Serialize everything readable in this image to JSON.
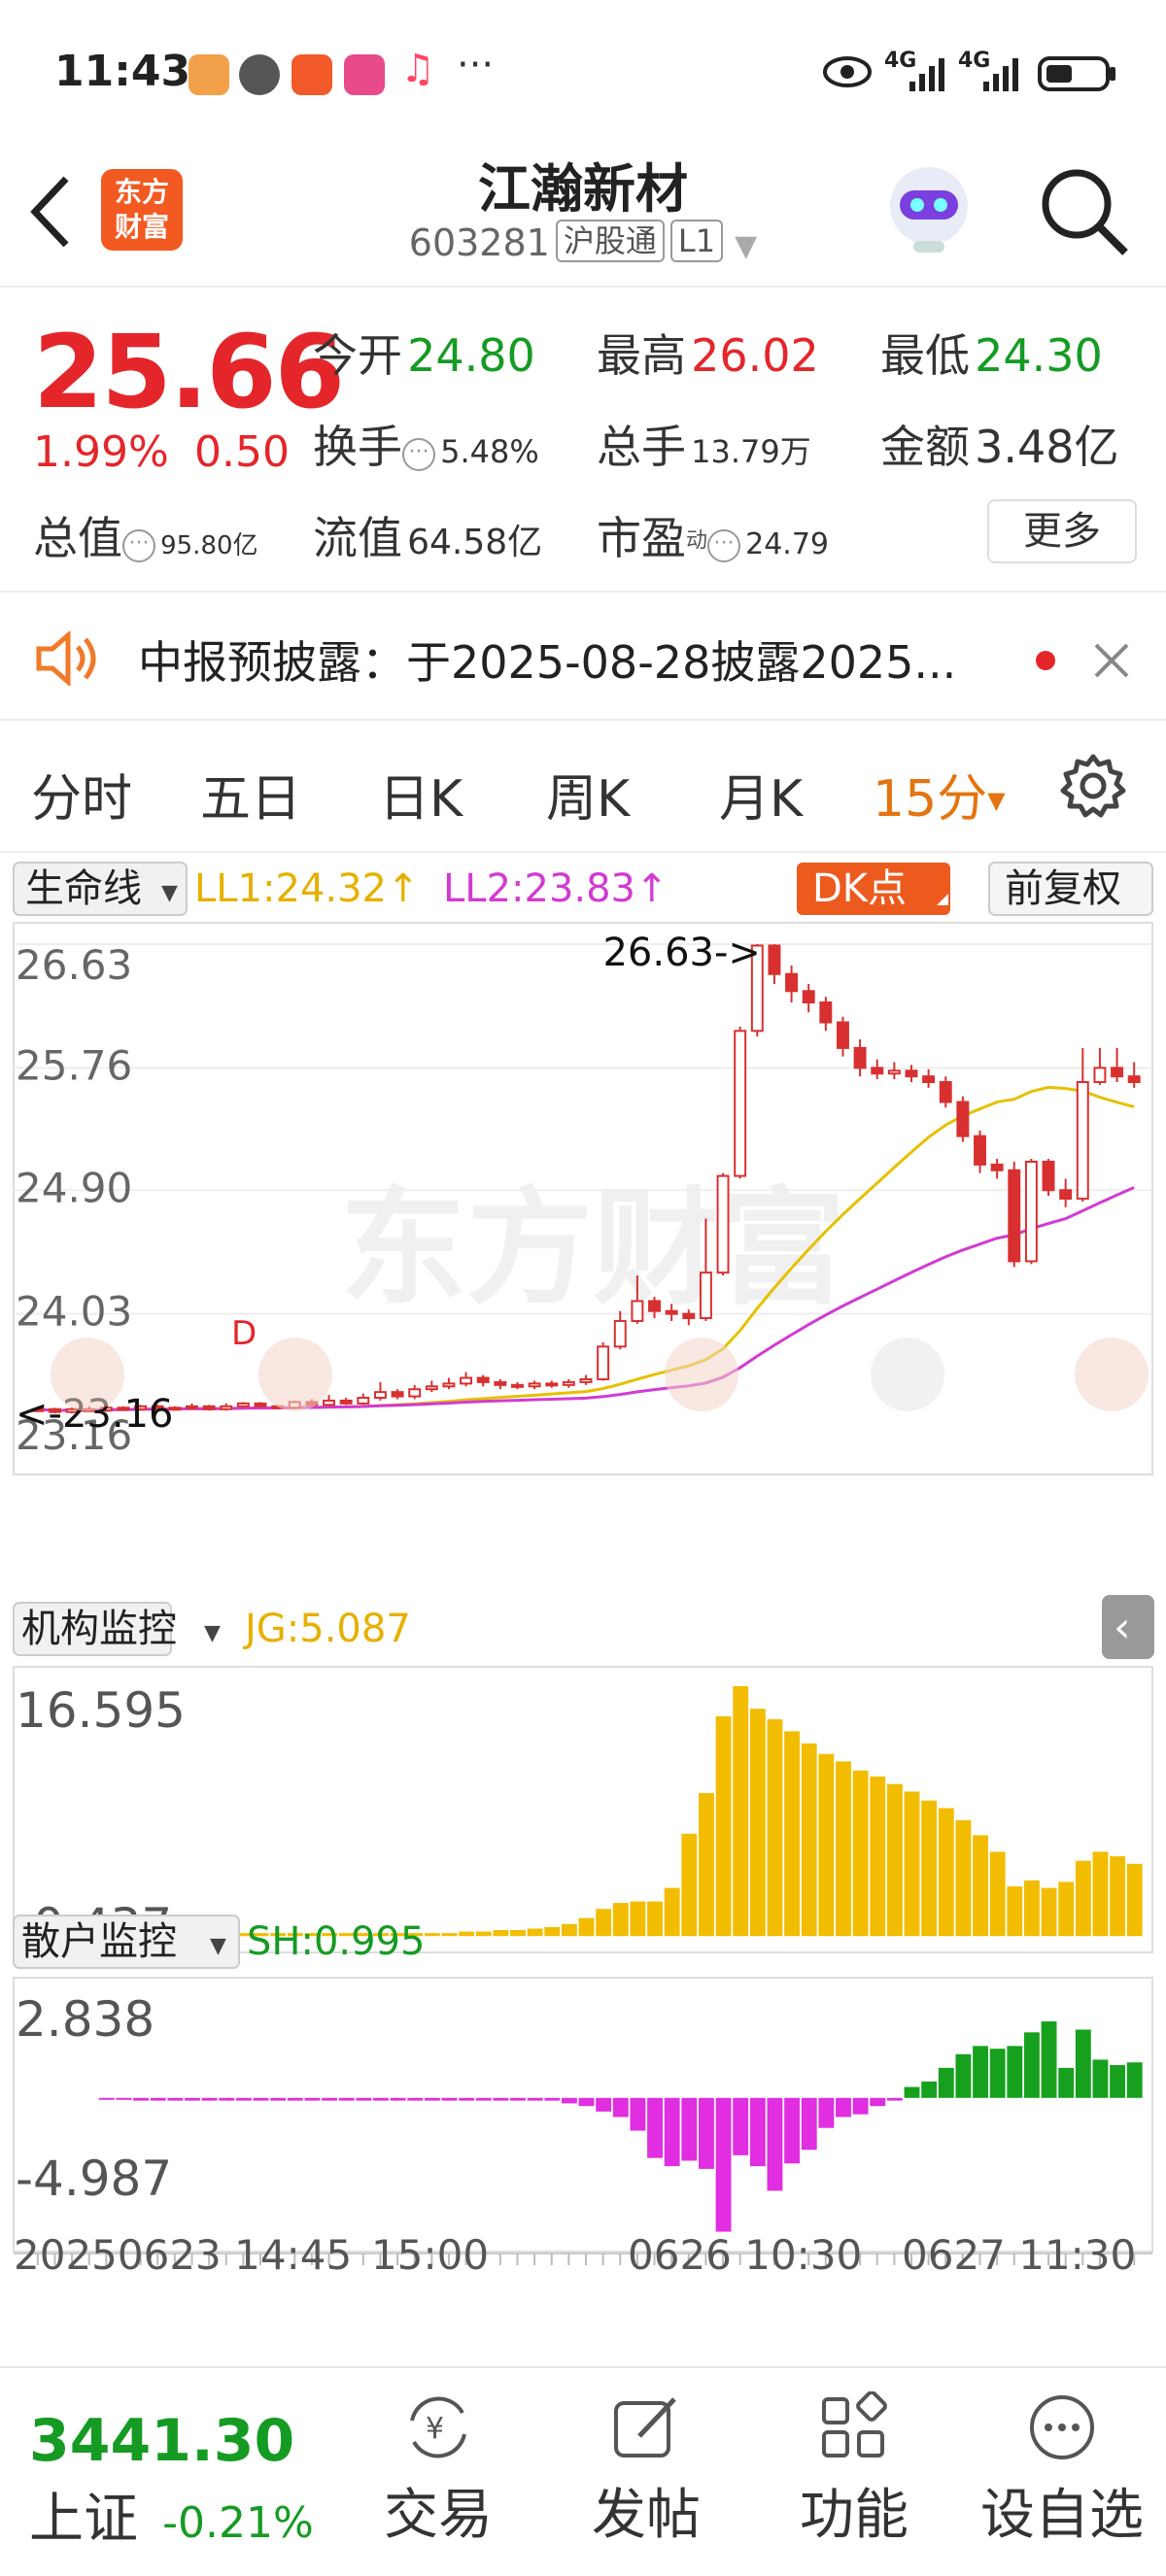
{
  "status_bar": {
    "time": "11:43",
    "more": "···",
    "net1": "4G",
    "net2": "4G",
    "app_colors": [
      "#f2a04a",
      "#555555",
      "#f25a2a",
      "#e84a8a",
      "#ff4466"
    ]
  },
  "header": {
    "logo_line1": "东方",
    "logo_line2": "财富",
    "stock_name": "江瀚新材",
    "stock_code": "603281",
    "tag1": "沪股通",
    "tag2": "L1"
  },
  "quote": {
    "price": "25.66",
    "change_pct": "1.99%",
    "change": "0.50",
    "open_label": "今开",
    "open": "24.80",
    "high_label": "最高",
    "high": "26.02",
    "low_label": "最低",
    "low": "24.30",
    "turnover_label": "换手",
    "turnover": "5.48%",
    "volume_label": "总手",
    "volume": "13.79万",
    "amount_label": "金额",
    "amount": "3.48亿",
    "mcap_label": "总值",
    "mcap": "95.80亿",
    "float_label": "流值",
    "float": "64.58亿",
    "pe_label": "市盈",
    "pe_sup": "动",
    "pe": "24.79",
    "more_button": "更多"
  },
  "notice": {
    "text": "中报预披露：于2025-08-28披露2025..."
  },
  "tabs": [
    {
      "label": "分时"
    },
    {
      "label": "五日"
    },
    {
      "label": "日K"
    },
    {
      "label": "周K"
    },
    {
      "label": "月K"
    },
    {
      "label": "15分"
    }
  ],
  "chart_toolbar": {
    "indicator": "生命线",
    "ll1": "LL1:24.32↑",
    "ll2": "LL2:23.83↑",
    "dk_button": "DK点",
    "adjust_button": "前复权",
    "watermark": "东方财富"
  },
  "chart_data": [
    {
      "type": "candlestick",
      "y_ticks": [
        "26.63",
        "25.76",
        "24.90",
        "24.03",
        "23.16"
      ],
      "ylim": [
        23.16,
        26.63
      ],
      "max_annotation": "26.63->",
      "min_annotation": "<-23.16",
      "marker": "D",
      "x_labels": [
        "20250623 14:45",
        "15:00",
        "0626 10:30",
        "0627 11:30"
      ],
      "candles": [
        [
          23.35,
          23.36,
          23.38,
          23.34
        ],
        [
          23.36,
          23.34,
          23.37,
          23.33
        ],
        [
          23.34,
          23.36,
          23.37,
          23.33
        ],
        [
          23.36,
          23.35,
          23.38,
          23.34
        ],
        [
          23.35,
          23.37,
          23.38,
          23.34
        ],
        [
          23.37,
          23.36,
          23.38,
          23.35
        ],
        [
          23.36,
          23.38,
          23.39,
          23.35
        ],
        [
          23.38,
          23.36,
          23.39,
          23.35
        ],
        [
          23.36,
          23.37,
          23.38,
          23.35
        ],
        [
          23.37,
          23.38,
          23.4,
          23.36
        ],
        [
          23.38,
          23.36,
          23.39,
          23.35
        ],
        [
          23.36,
          23.38,
          23.4,
          23.35
        ],
        [
          23.38,
          23.4,
          23.41,
          23.37
        ],
        [
          23.4,
          23.38,
          23.41,
          23.37
        ],
        [
          23.38,
          23.37,
          23.39,
          23.36
        ],
        [
          23.37,
          23.41,
          23.42,
          23.36
        ],
        [
          23.41,
          23.39,
          23.43,
          23.38
        ],
        [
          23.39,
          23.42,
          23.46,
          23.38
        ],
        [
          23.42,
          23.4,
          23.44,
          23.39
        ],
        [
          23.4,
          23.44,
          23.47,
          23.39
        ],
        [
          23.44,
          23.48,
          23.55,
          23.42
        ],
        [
          23.48,
          23.45,
          23.5,
          23.43
        ],
        [
          23.45,
          23.5,
          23.53,
          23.43
        ],
        [
          23.5,
          23.52,
          23.56,
          23.48
        ],
        [
          23.52,
          23.54,
          23.58,
          23.5
        ],
        [
          23.54,
          23.58,
          23.62,
          23.52
        ],
        [
          23.58,
          23.55,
          23.6,
          23.52
        ],
        [
          23.55,
          23.53,
          23.57,
          23.5
        ],
        [
          23.53,
          23.52,
          23.55,
          23.5
        ],
        [
          23.52,
          23.54,
          23.56,
          23.5
        ],
        [
          23.54,
          23.53,
          23.56,
          23.51
        ],
        [
          23.53,
          23.55,
          23.57,
          23.51
        ],
        [
          23.55,
          23.57,
          23.6,
          23.53
        ],
        [
          23.57,
          23.8,
          23.83,
          23.56
        ],
        [
          23.8,
          23.98,
          24.05,
          23.78
        ],
        [
          23.98,
          24.12,
          24.3,
          23.96
        ],
        [
          24.12,
          24.05,
          24.15,
          24.0
        ],
        [
          24.05,
          24.03,
          24.1,
          23.98
        ],
        [
          24.03,
          24.0,
          24.06,
          23.95
        ],
        [
          24.0,
          24.32,
          24.7,
          23.98
        ],
        [
          24.32,
          25.0,
          25.02,
          24.3
        ],
        [
          25.0,
          26.02,
          26.05,
          24.98
        ],
        [
          26.02,
          26.62,
          26.63,
          25.98
        ],
        [
          26.62,
          26.42,
          26.63,
          26.35
        ],
        [
          26.42,
          26.3,
          26.48,
          26.22
        ],
        [
          26.3,
          26.22,
          26.35,
          26.15
        ],
        [
          26.22,
          26.08,
          26.26,
          26.02
        ],
        [
          26.08,
          25.9,
          26.12,
          25.84
        ],
        [
          25.9,
          25.76,
          25.96,
          25.7
        ],
        [
          25.76,
          25.72,
          25.82,
          25.68
        ],
        [
          25.72,
          25.74,
          25.8,
          25.68
        ],
        [
          25.74,
          25.7,
          25.78,
          25.66
        ],
        [
          25.7,
          25.66,
          25.75,
          25.62
        ],
        [
          25.66,
          25.52,
          25.7,
          25.48
        ],
        [
          25.52,
          25.28,
          25.56,
          25.24
        ],
        [
          25.28,
          25.08,
          25.32,
          25.02
        ],
        [
          25.08,
          25.04,
          25.12,
          24.98
        ],
        [
          25.04,
          24.4,
          25.1,
          24.36
        ],
        [
          24.4,
          25.1,
          25.12,
          24.38
        ],
        [
          25.1,
          24.9,
          25.12,
          24.86
        ],
        [
          24.9,
          24.84,
          24.98,
          24.78
        ],
        [
          24.84,
          25.66,
          25.9,
          24.82
        ],
        [
          25.66,
          25.76,
          25.9,
          25.64
        ],
        [
          25.76,
          25.7,
          25.9,
          25.66
        ],
        [
          25.7,
          25.66,
          25.8,
          25.62
        ]
      ]
    },
    {
      "type": "bar",
      "title": "机构监控",
      "series_label": "JG:5.087",
      "y_ticks": [
        "16.595",
        "-0.437"
      ],
      "values": [
        0.2,
        0.2,
        0.2,
        0.2,
        0.2,
        0.2,
        0.2,
        0.2,
        0.2,
        0.2,
        0.2,
        0.2,
        0.2,
        0.2,
        0.2,
        0.2,
        0.2,
        0.2,
        0.2,
        0.2,
        0.2,
        0.3,
        0.3,
        0.4,
        0.4,
        0.5,
        0.6,
        0.8,
        1.2,
        1.8,
        2.2,
        2.3,
        2.3,
        3.2,
        6.8,
        9.5,
        14.6,
        16.6,
        15.1,
        14.4,
        13.6,
        12.8,
        12.1,
        11.6,
        11.0,
        10.6,
        10.1,
        9.6,
        9.0,
        8.5,
        7.7,
        6.7,
        5.6,
        3.3,
        3.7,
        3.2,
        3.6,
        5.0,
        5.6,
        5.3,
        4.8
      ]
    },
    {
      "type": "bar",
      "title": "散户监控",
      "series_label": "SH:0.995",
      "y_ticks": [
        "2.838",
        "-4.987"
      ],
      "values": [
        -0.05,
        -0.05,
        -0.1,
        -0.1,
        -0.1,
        -0.1,
        -0.1,
        -0.1,
        -0.1,
        -0.1,
        -0.1,
        -0.1,
        -0.1,
        -0.1,
        -0.1,
        -0.1,
        -0.1,
        -0.1,
        -0.1,
        -0.1,
        -0.1,
        -0.1,
        -0.1,
        -0.1,
        -0.1,
        -0.1,
        -0.1,
        -0.2,
        -0.3,
        -0.5,
        -0.7,
        -1.2,
        -2.2,
        -2.5,
        -2.3,
        -2.6,
        -4.9,
        -2.1,
        -2.5,
        -3.4,
        -2.4,
        -1.9,
        -1.1,
        -0.7,
        -0.6,
        -0.3,
        -0.1,
        0.4,
        0.6,
        1.1,
        1.6,
        1.9,
        1.8,
        1.9,
        2.4,
        2.8,
        1.1,
        2.5,
        1.4,
        1.2,
        1.3
      ]
    }
  ],
  "chart_overlay": {
    "right_panel_toggle": "‹"
  },
  "footer": {
    "index_value": "3441.30",
    "index_name": "上证",
    "index_change": "-0.21%",
    "trade": "交易",
    "post": "发帖",
    "functions": "功能",
    "watchlist": "设自选"
  }
}
